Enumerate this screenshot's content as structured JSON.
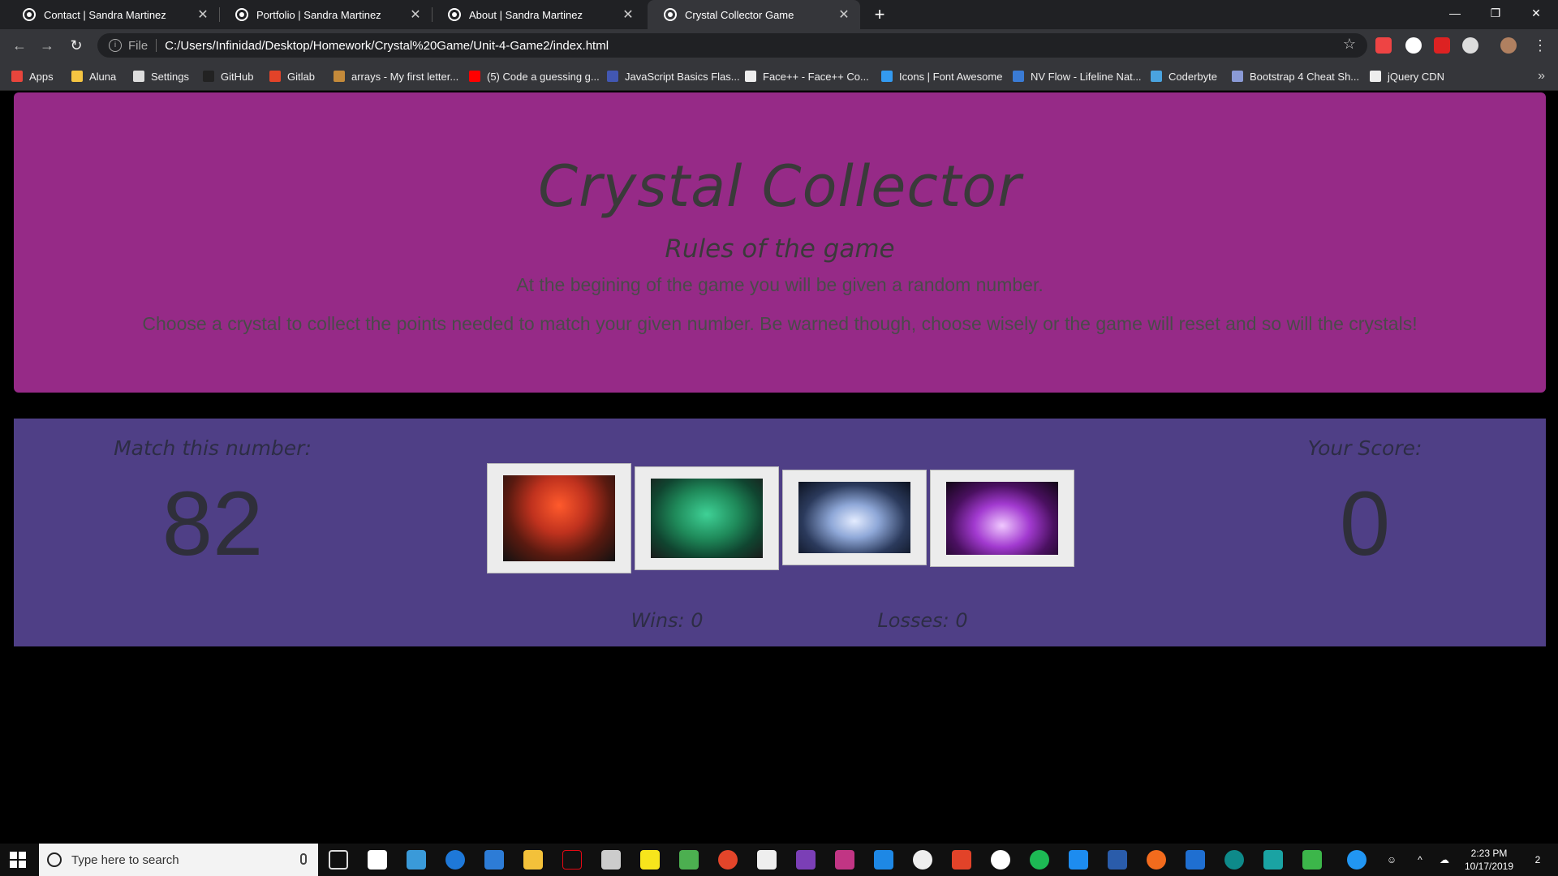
{
  "browser": {
    "tabs": [
      {
        "title": "Contact | Sandra Martinez",
        "active": false
      },
      {
        "title": "Portfolio | Sandra Martinez",
        "active": false
      },
      {
        "title": "About | Sandra Martinez",
        "active": false
      },
      {
        "title": "Crystal Collector Game",
        "active": true
      }
    ],
    "new_tab": "+",
    "window_controls": {
      "minimize": "—",
      "restore": "❐",
      "close": "✕"
    },
    "address": {
      "scheme": "File",
      "url": "C:/Users/Infinidad/Desktop/Homework/Crystal%20Game/Unit-4-Game2/index.html"
    },
    "bookmarks": [
      {
        "label": "Apps",
        "icon": "apps-grid-icon",
        "color": "#e8453c"
      },
      {
        "label": "Aluna",
        "icon": "folder-icon",
        "color": "#f5c542"
      },
      {
        "label": "Settings",
        "icon": "gear-icon",
        "color": "#dddddd"
      },
      {
        "label": "GitHub",
        "icon": "github-icon",
        "color": "#222222"
      },
      {
        "label": "Gitlab",
        "icon": "gitlab-icon",
        "color": "#e24329"
      },
      {
        "label": "arrays - My first letter...",
        "icon": "arrays-icon",
        "color": "#c48a3a"
      },
      {
        "label": "(5) Code a guessing g...",
        "icon": "youtube-icon",
        "color": "#ff0000"
      },
      {
        "label": "JavaScript Basics Flas...",
        "icon": "quizlet-icon",
        "color": "#4257b2"
      },
      {
        "label": "Face++ - Face++ Co...",
        "icon": "faceplusplus-icon",
        "color": "#eeeeee"
      },
      {
        "label": "Icons | Font Awesome",
        "icon": "fontawesome-icon",
        "color": "#339af0"
      },
      {
        "label": "NV Flow - Lifeline Nat...",
        "icon": "flow-icon",
        "color": "#3a7bd5"
      },
      {
        "label": "Coderbyte",
        "icon": "coderbyte-icon",
        "color": "#4aa3df"
      },
      {
        "label": "Bootstrap 4 Cheat Sh...",
        "icon": "bootstrap-icon",
        "color": "#8a9ad6"
      },
      {
        "label": "jQuery CDN",
        "icon": "jquery-icon",
        "color": "#eeeeee"
      }
    ]
  },
  "game": {
    "title": "Crystal Collector",
    "rules_title": "Rules of the game",
    "rule_1": "At the begining of the game you will be given a random number.",
    "rule_2": "Choose a crystal to collect the points needed to match your given number. Be warned though, choose wisely or the game will reset and so will the crystals!",
    "match_label": "Match this number:",
    "match_value": "82",
    "score_label": "Your Score:",
    "score_value": "0",
    "wins_label": "Wins: 0",
    "losses_label": "Losses: 0",
    "crystals": [
      {
        "name": "red-crystal",
        "color": "#c0321e"
      },
      {
        "name": "green-crystal",
        "color": "#1f8a5a"
      },
      {
        "name": "blue-crystal",
        "color": "#8fa8d8"
      },
      {
        "name": "purple-crystal",
        "color": "#a23ad0"
      }
    ]
  },
  "taskbar": {
    "search_placeholder": "Type here to search",
    "time": "2:23 PM",
    "date": "10/17/2019",
    "notification_count": "2"
  }
}
